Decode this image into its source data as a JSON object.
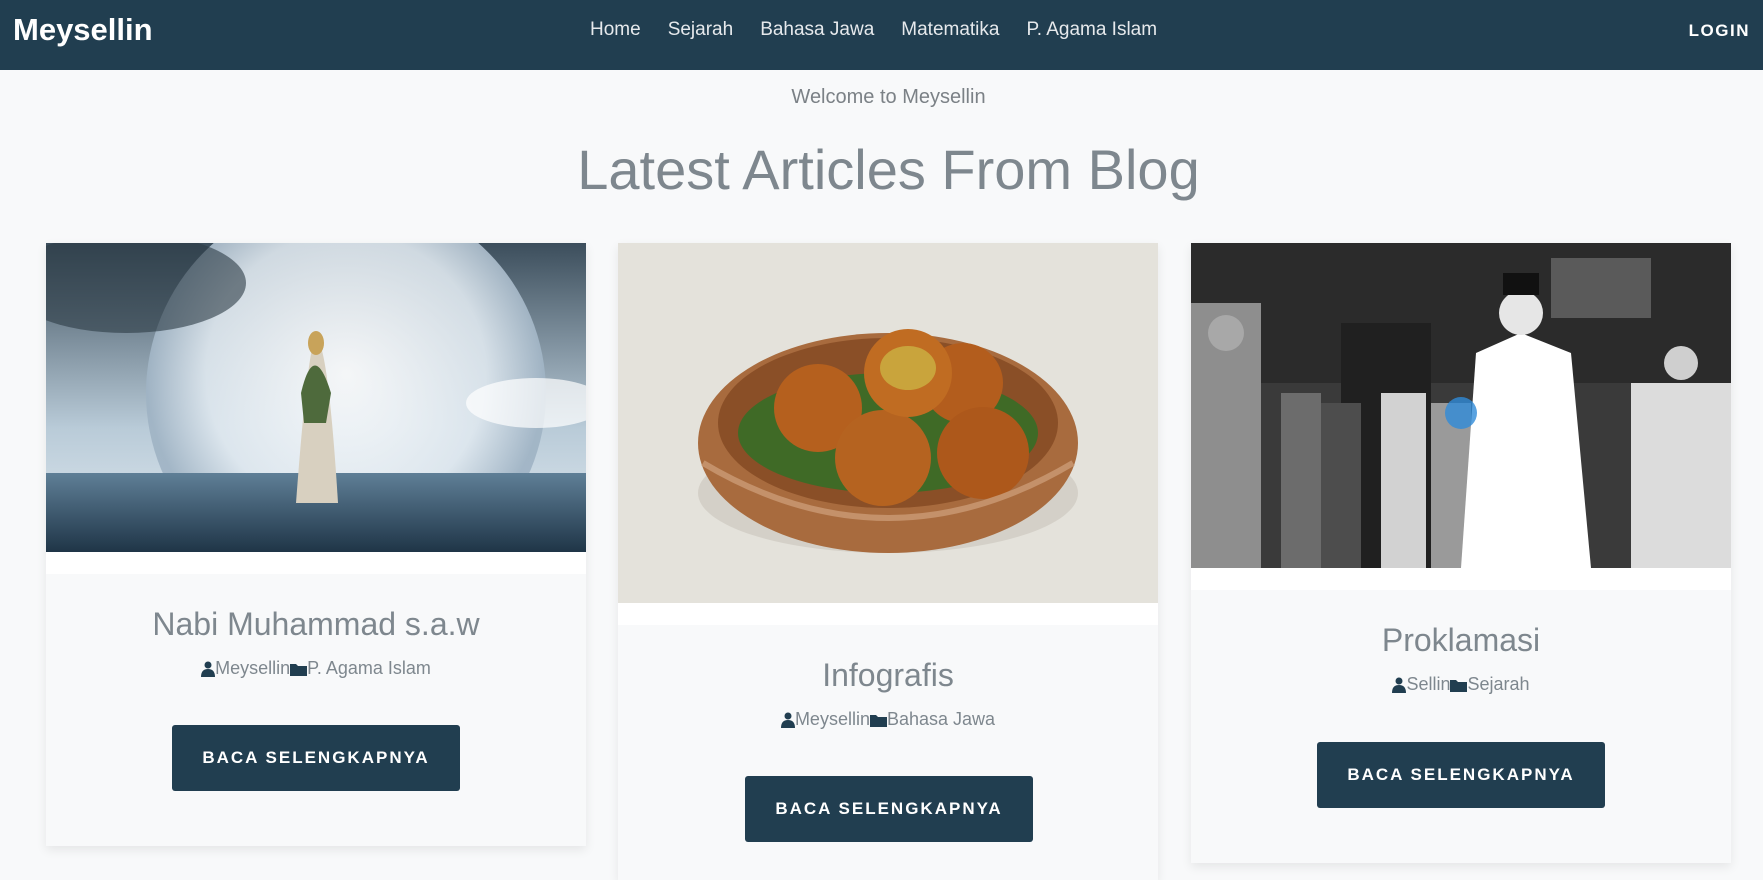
{
  "navbar": {
    "brand": "Meysellin",
    "links": [
      "Home",
      "Sejarah",
      "Bahasa Jawa",
      "Matematika",
      "P. Agama Islam"
    ],
    "login": "LOGIN",
    "background": "#213e50"
  },
  "hero": {
    "welcome": "Welcome to Meysellin",
    "headline": "Latest Articles From Blog"
  },
  "articles": [
    {
      "title": "Nabi Muhammad s.a.w",
      "author": "Meysellin",
      "category": "P. Agama Islam",
      "button": "BACA SELENGKAPNYA",
      "image": "figure-walking-on-water-under-full-moon"
    },
    {
      "title": "Infografis",
      "author": "Meysellin",
      "category": "Bahasa Jawa",
      "button": "BACA SELENGKAPNYA",
      "image": "fried-snacks-in-bamboo-basket"
    },
    {
      "title": "Proklamasi",
      "author": "Sellin",
      "category": "Sejarah",
      "button": "BACA SELENGKAPNYA",
      "image": "black-and-white-proclamation-photo"
    }
  ],
  "colors": {
    "accent": "#213e50",
    "text_muted": "#7e878e",
    "page_background": "#f8f9fa"
  }
}
